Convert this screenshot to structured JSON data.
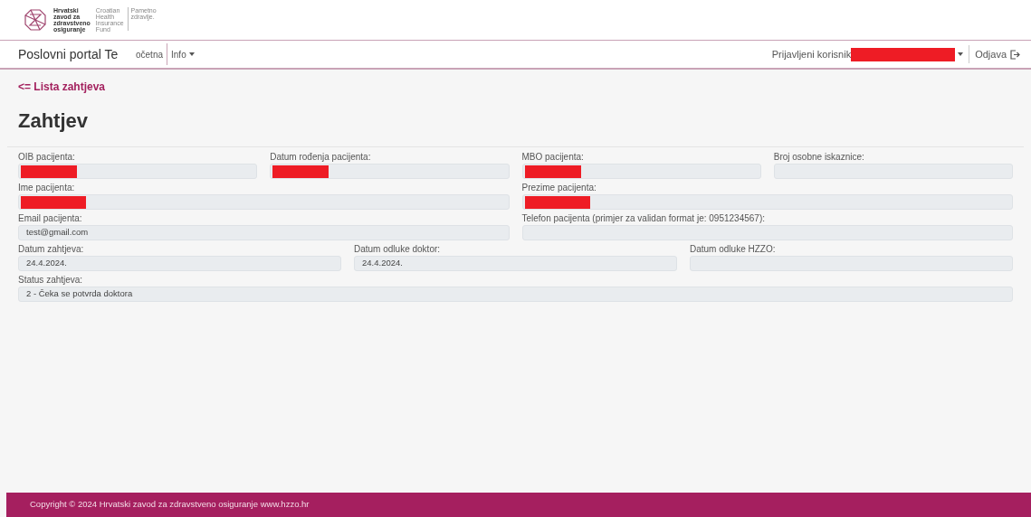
{
  "logo": {
    "name_lines": [
      "Hrvatski",
      "zavod za",
      "zdravstveno",
      "osiguranje"
    ],
    "english_lines": [
      "Croatian",
      "Health",
      "Insurance",
      "Fund"
    ],
    "slogan_lines": [
      "Pametno",
      "zdravlje."
    ]
  },
  "navbar": {
    "brand": "Poslovni portal Te",
    "links": [
      {
        "label": "očetna",
        "dropdown": false
      },
      {
        "label": "Info",
        "dropdown": true
      }
    ],
    "user_label": "Prijavljeni korisnik",
    "user_redacted": true,
    "logout": "Odjava"
  },
  "back_link": "<= Lista zahtjeva",
  "heading": "Zahtjev",
  "form_rows": [
    {
      "fields": [
        {
          "label": "OIB pacijenta:",
          "redacted": true
        },
        {
          "label": "Datum rođenja pacijenta:",
          "redacted": true
        },
        {
          "label": "MBO pacijenta:",
          "redacted": true
        },
        {
          "label": "Broj osobne iskaznice:",
          "redacted": false
        }
      ]
    },
    {
      "fields": [
        {
          "label": "Ime pacijenta:",
          "redacted": true
        },
        {
          "label": "Prezime pacijenta:",
          "redacted": true
        }
      ]
    },
    {
      "fields": [
        {
          "label": "Email pacijenta:",
          "value": "test@gmail.com",
          "redacted": false
        },
        {
          "label": "Telefon pacijenta (primjer za validan format je: 0951234567):",
          "redacted": false
        }
      ]
    },
    {
      "fields": [
        {
          "label": "Datum zahtjeva:",
          "value": "24.4.2024.",
          "redacted": false
        },
        {
          "label": "Datum odluke doktor:",
          "value": "24.4.2024.",
          "redacted": false
        },
        {
          "label": "Datum odluke HZZO:",
          "redacted": false
        }
      ]
    },
    {
      "fields": [
        {
          "label": "Status zahtjeva:",
          "value": "2 - Čeka se potvrda doktora",
          "redacted": false
        }
      ]
    }
  ],
  "footer": "Copyright © 2024 Hrvatski zavod za zdravstveno osiguranje www.hzzo.hr"
}
